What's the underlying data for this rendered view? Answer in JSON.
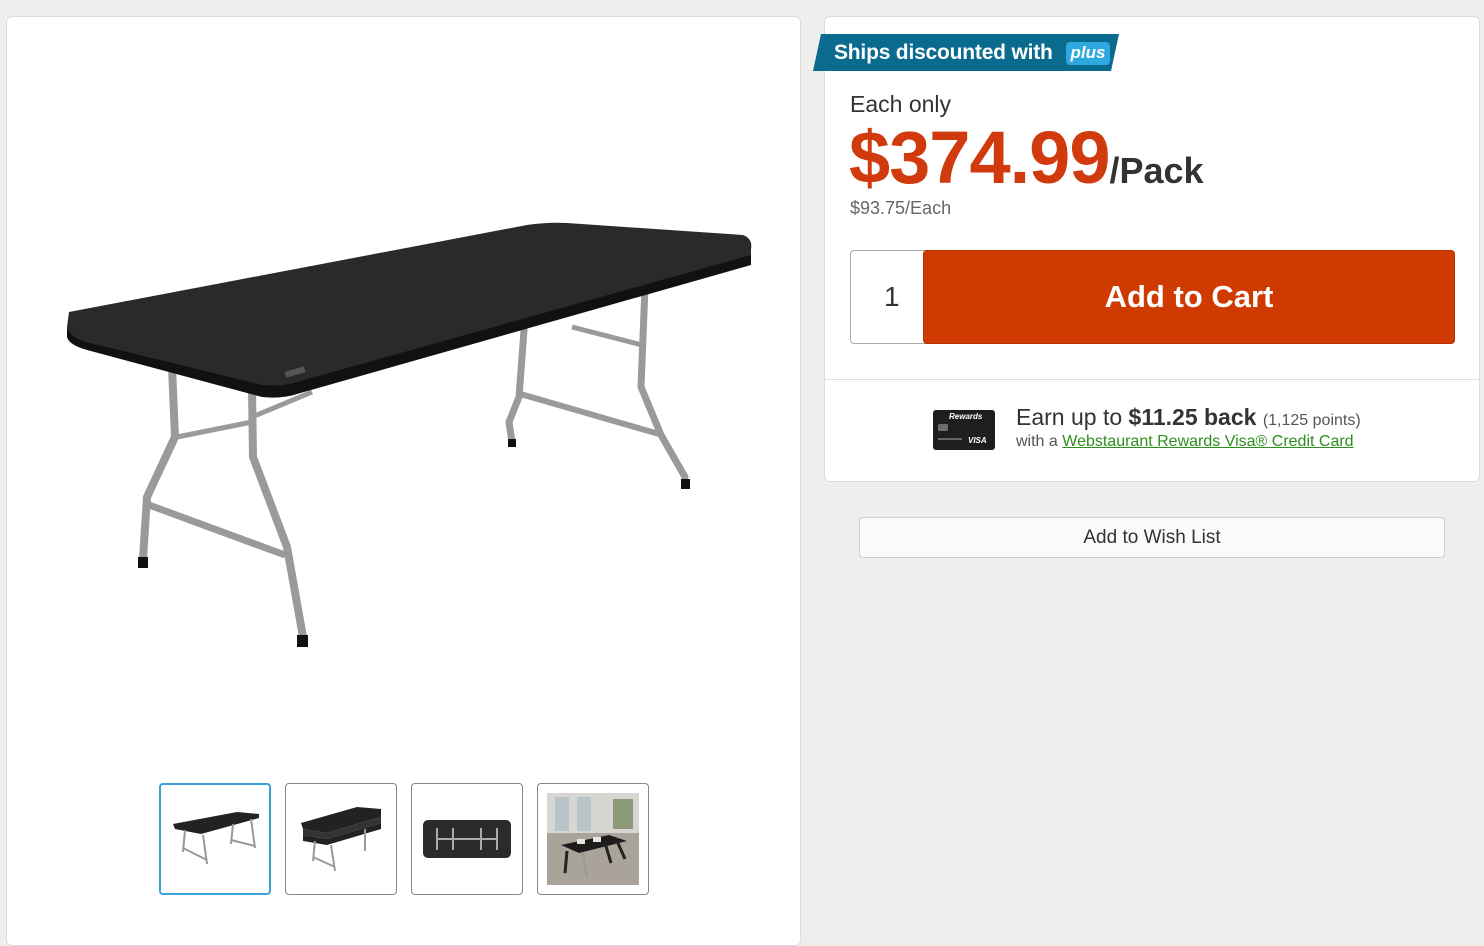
{
  "gallery": {
    "main_image_icon": "folding-table-image",
    "thumbnails": [
      {
        "name": "thumb-table-open",
        "active": true
      },
      {
        "name": "thumb-tables-stacked",
        "active": false
      },
      {
        "name": "thumb-table-folded",
        "active": false
      },
      {
        "name": "thumb-table-room",
        "active": false
      }
    ]
  },
  "purchase": {
    "plus_banner_text": "Ships discounted with",
    "plus_badge": "plus",
    "each_only": "Each only",
    "price": "$374.99",
    "per_pack": "/Pack",
    "per_each": "$93.75/Each",
    "quantity": "1",
    "add_to_cart": "Add to Cart"
  },
  "rewards": {
    "card_label_rewards": "Rewards",
    "card_label_visa": "VISA",
    "earn_prefix": "Earn up to ",
    "earn_amount": "$11.25 back",
    "earn_points": "(1,125 points)",
    "with_a": "with a ",
    "link_text": "Webstaurant Rewards Visa® Credit Card"
  },
  "wishlist": {
    "label": "Add to Wish List"
  },
  "colors": {
    "price": "#d03a0c",
    "cart_button": "#cf3a00",
    "plus_banner": "#0a6b8e",
    "plus_badge": "#2fa8e0",
    "link": "#2d8f1d",
    "thumb_active": "#39a3d6"
  }
}
